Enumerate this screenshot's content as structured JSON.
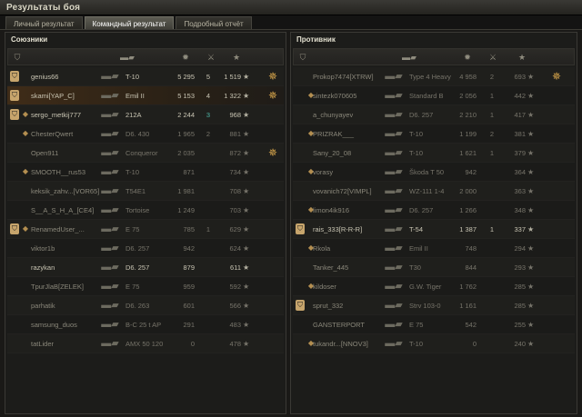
{
  "window": {
    "title": "Результаты боя"
  },
  "tabs": [
    {
      "label": "Личный результат",
      "active": false
    },
    {
      "label": "Командный результат",
      "active": true
    },
    {
      "label": "Подробный отчёт",
      "active": false
    }
  ],
  "allies": {
    "title": "Союзники",
    "rows": [
      {
        "platoon": true,
        "rank": false,
        "name": "genius66",
        "tank": "T-10",
        "dmg": "5 295",
        "kills": "5",
        "xp": "1 519",
        "medal": true,
        "self": false,
        "dim": false,
        "kills_green": false
      },
      {
        "platoon": true,
        "rank": false,
        "name": "skami[YAP_C]",
        "tank": "Emil II",
        "dmg": "5 153",
        "kills": "4",
        "xp": "1 322",
        "medal": true,
        "self": true,
        "dim": false,
        "kills_green": false
      },
      {
        "platoon": true,
        "rank": true,
        "name": "sergo_metkij777",
        "tank": "212A",
        "dmg": "2 244",
        "kills": "3",
        "xp": "968",
        "medal": false,
        "self": false,
        "dim": false,
        "kills_green": true
      },
      {
        "platoon": false,
        "rank": true,
        "name": "ChesterQwert",
        "tank": "D6. 430",
        "dmg": "1 965",
        "kills": "2",
        "xp": "881",
        "medal": false,
        "self": false,
        "dim": true,
        "kills_green": false
      },
      {
        "platoon": false,
        "rank": false,
        "name": "Open911",
        "tank": "Conqueror",
        "dmg": "2 035",
        "kills": "",
        "xp": "872",
        "medal": true,
        "self": false,
        "dim": true,
        "kills_green": false
      },
      {
        "platoon": false,
        "rank": true,
        "name": "SMOOTH__rus53",
        "tank": "T-10",
        "dmg": "871",
        "kills": "",
        "xp": "734",
        "medal": false,
        "self": false,
        "dim": true,
        "kills_green": false
      },
      {
        "platoon": false,
        "rank": false,
        "name": "keksik_zahv...[VOR65]",
        "tank": "T54E1",
        "dmg": "1 981",
        "kills": "",
        "xp": "708",
        "medal": false,
        "self": false,
        "dim": true,
        "kills_green": false
      },
      {
        "platoon": false,
        "rank": false,
        "name": "S__A_S_H_A_[CE4]",
        "tank": "Tortoise",
        "dmg": "1 249",
        "kills": "",
        "xp": "703",
        "medal": false,
        "self": false,
        "dim": true,
        "kills_green": false
      },
      {
        "platoon": true,
        "rank": true,
        "name": "RenamedUser_...",
        "tank": "E 75",
        "dmg": "785",
        "kills": "1",
        "xp": "629",
        "medal": false,
        "self": false,
        "dim": true,
        "kills_green": false
      },
      {
        "platoon": false,
        "rank": false,
        "name": "viktor1b",
        "tank": "D6. 257",
        "dmg": "942",
        "kills": "",
        "xp": "624",
        "medal": false,
        "self": false,
        "dim": true,
        "kills_green": false
      },
      {
        "platoon": false,
        "rank": false,
        "name": "razykan",
        "tank": "D6. 257",
        "dmg": "879",
        "kills": "",
        "xp": "611",
        "medal": false,
        "self": false,
        "dim": false,
        "kills_green": false
      },
      {
        "platoon": false,
        "rank": false,
        "name": "TpurJlaB[ZELEK]",
        "tank": "E 75",
        "dmg": "959",
        "kills": "",
        "xp": "592",
        "medal": false,
        "self": false,
        "dim": true,
        "kills_green": false
      },
      {
        "platoon": false,
        "rank": false,
        "name": "parhatik",
        "tank": "D6. 263",
        "dmg": "601",
        "kills": "",
        "xp": "566",
        "medal": false,
        "self": false,
        "dim": true,
        "kills_green": false
      },
      {
        "platoon": false,
        "rank": false,
        "name": "samsung_duos",
        "tank": "B-C 25 t AP",
        "dmg": "291",
        "kills": "",
        "xp": "483",
        "medal": false,
        "self": false,
        "dim": true,
        "kills_green": false
      },
      {
        "platoon": false,
        "rank": false,
        "name": "tatLider",
        "tank": "AMX 50 120",
        "dmg": "0",
        "kills": "",
        "xp": "478",
        "medal": false,
        "self": false,
        "dim": true,
        "kills_green": false
      }
    ]
  },
  "enemies": {
    "title": "Противник",
    "rows": [
      {
        "platoon": false,
        "rank": false,
        "name": "Prokop7474[XTRW]",
        "tank": "Type 4 Heavy",
        "dmg": "4 958",
        "kills": "2",
        "xp": "693",
        "medal": true,
        "dim": true
      },
      {
        "platoon": false,
        "rank": true,
        "name": "sintezk070605",
        "tank": "Standard B",
        "dmg": "2 056",
        "kills": "1",
        "xp": "442",
        "medal": false,
        "dim": true
      },
      {
        "platoon": false,
        "rank": false,
        "name": "a_chunyayev",
        "tank": "D6. 257",
        "dmg": "2 210",
        "kills": "1",
        "xp": "417",
        "medal": false,
        "dim": true
      },
      {
        "platoon": false,
        "rank": true,
        "name": "PRIZRAK___",
        "tank": "T-10",
        "dmg": "1 199",
        "kills": "2",
        "xp": "381",
        "medal": false,
        "dim": true
      },
      {
        "platoon": false,
        "rank": false,
        "name": "Sany_20_08",
        "tank": "T-10",
        "dmg": "1 621",
        "kills": "1",
        "xp": "379",
        "medal": false,
        "dim": true
      },
      {
        "platoon": false,
        "rank": true,
        "name": "vorasy",
        "tank": "Škoda T 50",
        "dmg": "942",
        "kills": "",
        "xp": "364",
        "medal": false,
        "dim": true
      },
      {
        "platoon": false,
        "rank": false,
        "name": "vovanich72[VIMPL]",
        "tank": "WZ-111 1-4",
        "dmg": "2 000",
        "kills": "",
        "xp": "363",
        "medal": false,
        "dim": true
      },
      {
        "platoon": false,
        "rank": true,
        "name": "limon4ik916",
        "tank": "D6. 257",
        "dmg": "1 266",
        "kills": "",
        "xp": "348",
        "medal": false,
        "dim": true
      },
      {
        "platoon": true,
        "rank": false,
        "name": "rais_333[R-R-R]",
        "tank": "T-54",
        "dmg": "1 387",
        "kills": "1",
        "xp": "337",
        "medal": false,
        "dim": false
      },
      {
        "platoon": false,
        "rank": true,
        "name": "Rkola",
        "tank": "Emil II",
        "dmg": "748",
        "kills": "",
        "xp": "294",
        "medal": false,
        "dim": true
      },
      {
        "platoon": false,
        "rank": false,
        "name": "Tanker_445",
        "tank": "T30",
        "dmg": "844",
        "kills": "",
        "xp": "293",
        "medal": false,
        "dim": true
      },
      {
        "platoon": false,
        "rank": true,
        "name": "kildoser",
        "tank": "G.W. Tiger",
        "dmg": "1 762",
        "kills": "",
        "xp": "285",
        "medal": false,
        "dim": true
      },
      {
        "platoon": true,
        "rank": false,
        "name": "sprut_332",
        "tank": "Strv 103-0",
        "dmg": "1 161",
        "kills": "",
        "xp": "285",
        "medal": false,
        "dim": true
      },
      {
        "platoon": false,
        "rank": false,
        "name": "GANSTERPORT",
        "tank": "E 75",
        "dmg": "542",
        "kills": "",
        "xp": "255",
        "medal": false,
        "dim": true
      },
      {
        "platoon": false,
        "rank": true,
        "name": "tukandr...[NNOV3]",
        "tank": "T-10",
        "dmg": "0",
        "kills": "",
        "xp": "240",
        "medal": false,
        "dim": true
      }
    ]
  },
  "icons": {
    "platoon": "platoon-icon",
    "rank": "rank-icon",
    "tank": "tank-icon",
    "medal": "medal-icon",
    "star": "xp-star-icon"
  },
  "colors": {
    "self_row": "#3f2c18",
    "kills_highlight": "#4fb6a8",
    "medal": "#d8a64c"
  }
}
